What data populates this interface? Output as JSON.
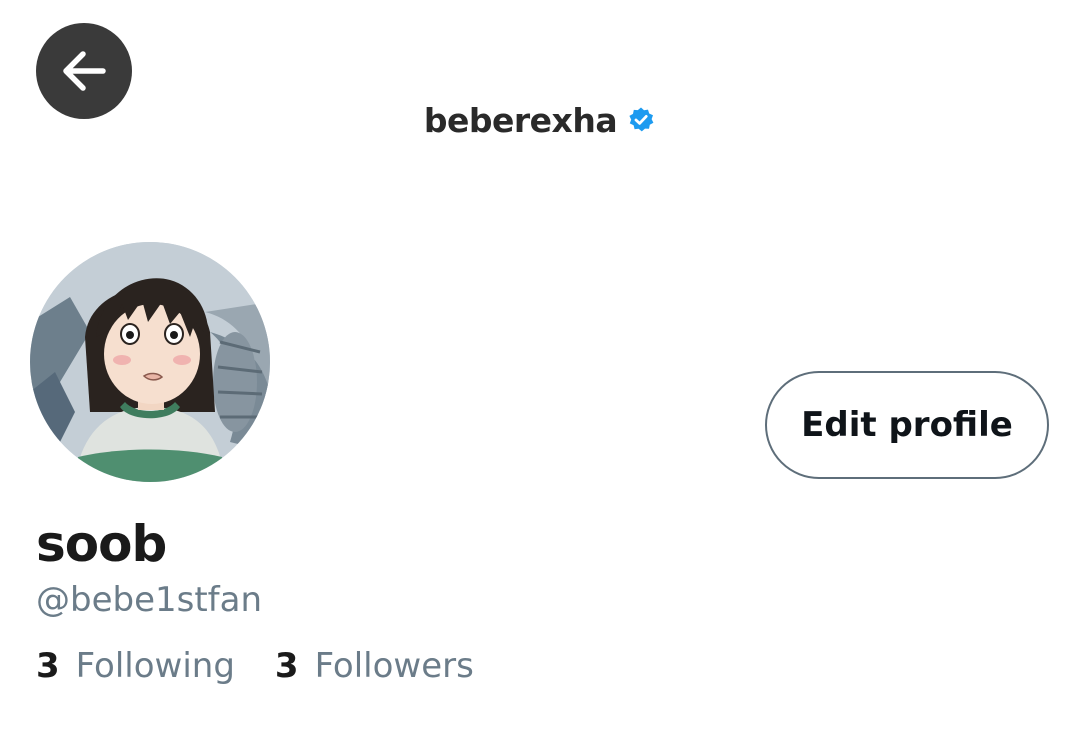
{
  "header": {
    "back_icon": "arrow-left-icon",
    "title": "beberexha",
    "verified_icon": "verified-badge-icon",
    "verified_color": "#1d9bf0"
  },
  "profile": {
    "avatar": "avatar-image",
    "display_name": "soob",
    "handle": "@bebe1stfan",
    "edit_label": "Edit profile"
  },
  "stats": {
    "following_count": "3",
    "following_label": "Following",
    "followers_count": "3",
    "followers_label": "Followers"
  }
}
